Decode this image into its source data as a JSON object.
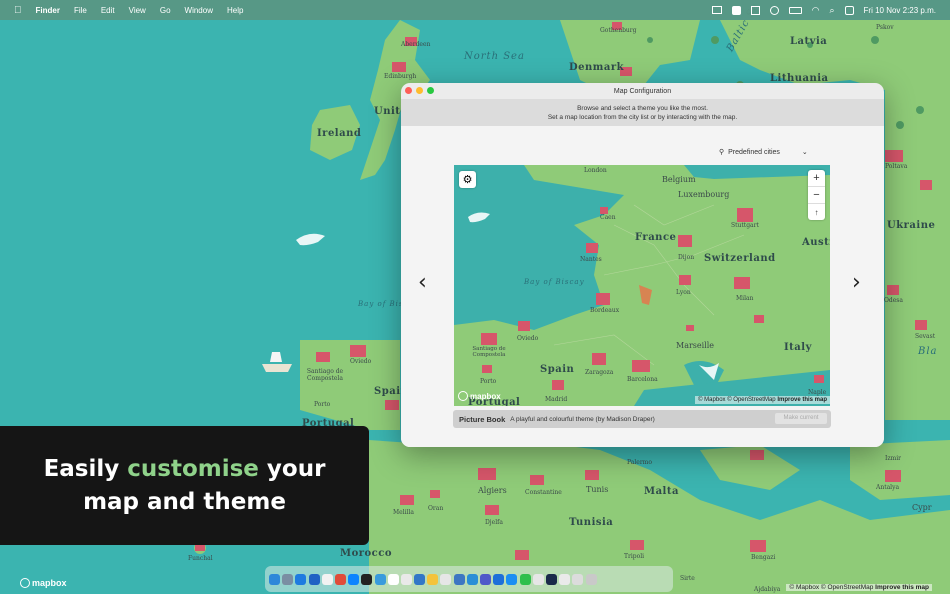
{
  "menubar": {
    "app_name": "Finder",
    "menus": [
      "File",
      "Edit",
      "View",
      "Go",
      "Window",
      "Help"
    ],
    "datetime": "Fri 10 Nov  2:23 p.m.",
    "status_icons": [
      "map-icon",
      "check-icon",
      "grid-icon",
      "play-icon",
      "battery-icon",
      "wifi-icon",
      "search-icon",
      "control-center-icon"
    ]
  },
  "map_labels": {
    "north_sea": "North Sea",
    "baltic_sea": "Baltic Se",
    "denmark": "Denmark",
    "latvia": "Latvia",
    "lithuania": "Lithuania",
    "ireland": "Ireland",
    "united": "Unite",
    "ukraine": "Ukraine",
    "aberdeen": "Aberdeen",
    "edinburgh": "Edinburgh",
    "gothenburg": "Gothenburg",
    "pskov": "Pskov",
    "bay_of_biscay": "Bay of Bisc",
    "spain": "Spain",
    "portugal": "Portugal",
    "santiago": "Santiago de Compostela",
    "oviedo": "Oviedo",
    "porto": "Porto",
    "morocco": "Morocco",
    "algiers": "Algiers",
    "constantine": "Constantine",
    "tunis": "Tunis",
    "tunisia": "Tunisia",
    "malta": "Malta",
    "melilla": "Melilla",
    "oran": "Oran",
    "djelfa": "Djelfa",
    "funchal": "Funchal",
    "tripoli": "Tripoli",
    "sirte": "Sirte",
    "benghazi": "Bengazi",
    "adjabia": "Ajdabiya",
    "antalya": "Antalya",
    "izmir": "Izmir",
    "palermo": "Palermo",
    "bla": "Bla",
    "cypr": "Cypr",
    "odessa": "Odesa",
    "sevast": "Sevast",
    "poltava": "Poltava"
  },
  "window": {
    "title": "Map Configuration",
    "description_line1": "Browse and select a theme you like the most.",
    "description_line2": "Set a map location from the city list or by interacting with the map.",
    "city_select": "Predefined cities",
    "prev_arrow": "‹",
    "next_arrow": "›",
    "preview_labels": {
      "london": "London",
      "belgium": "Belgium",
      "luxembourg": "Luxembourg",
      "stuttgart": "Stuttgart",
      "austria": "Austri",
      "france": "France",
      "caen": "Caen",
      "dijon": "Dijon",
      "nantes": "Nantes",
      "switzerland": "Switzerland",
      "lyon": "Lyon",
      "milan": "Milan",
      "bordeaux": "Bordeaux",
      "bay_of_biscay": "Bay of Biscay",
      "marseille": "Marseille",
      "italy": "Italy",
      "santiago": "Santiago de Compostela",
      "oviedo": "Oviedo",
      "zaragoza": "Zaragoza",
      "spain": "Spain",
      "barcelona": "Barcelona",
      "porto": "Porto",
      "madrid": "Madrid",
      "napl": "Naple",
      "portugal": "Portugal"
    },
    "zoom_in": "+",
    "zoom_out": "−",
    "reset": "↑",
    "attribution": "© Mapbox © OpenStreetMap",
    "improve": "Improve this map",
    "mapbox_logo": "mapbox",
    "theme_name": "Picture Book",
    "theme_desc": "A playful and colourful theme (by Madison Draper)",
    "make_current": "Make current"
  },
  "banner": {
    "line1_prefix": "Easily ",
    "line1_accent": "customise",
    "line1_suffix": " your",
    "line2": "map and theme"
  },
  "bottom": {
    "mapbox_logo": "mapbox",
    "attribution": "© Mapbox © OpenStreetMap",
    "improve": "Improve this map"
  },
  "colors": {
    "sea": "#3bb4b0",
    "land": "#8fcb78",
    "accent": "#8fd28a",
    "city": "#d6566a"
  }
}
